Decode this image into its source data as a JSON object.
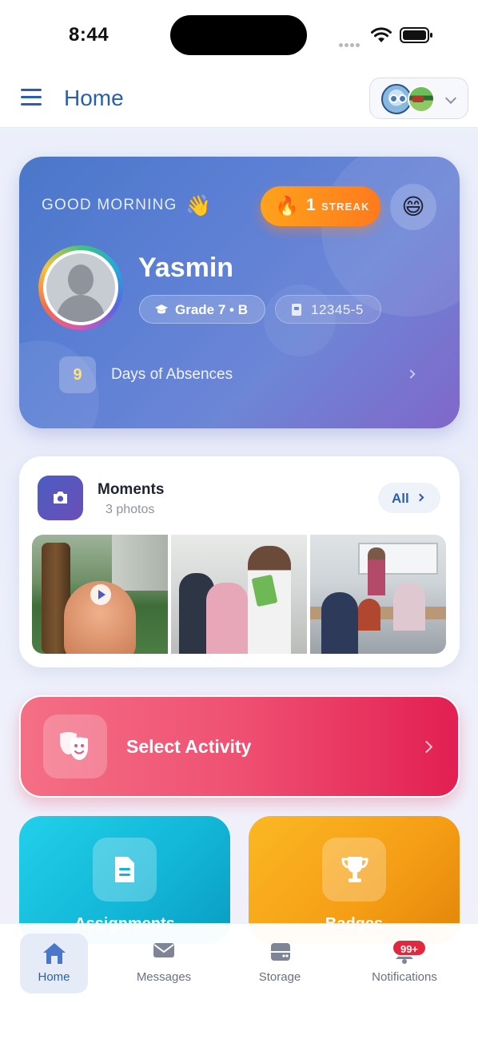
{
  "status_bar": {
    "time": "8:44"
  },
  "header": {
    "title": "Home"
  },
  "hero": {
    "greeting": "GOOD MORNING",
    "greeting_emoji": "👋",
    "streak_emoji": "🔥",
    "streak_count": "1",
    "streak_label": "STREAK",
    "mood_emoji": "😄",
    "student_name": "Yasmin",
    "grade": "Grade 7 • B",
    "student_id": "12345-5",
    "absences_count": "9",
    "absences_label": "Days of Absences"
  },
  "moments": {
    "title": "Moments",
    "count": "3 photos",
    "all_label": "All",
    "photos": [
      "animated-video-thumbnail",
      "students-classroom",
      "classroom-teacher"
    ]
  },
  "activity": {
    "label": "Select Activity"
  },
  "tiles": [
    {
      "label": "Assignments",
      "icon": "document-icon",
      "color": "#12b5d6"
    },
    {
      "label": "Badges",
      "icon": "trophy-icon",
      "color": "#f59d15"
    }
  ],
  "nav": {
    "home": "Home",
    "messages": "Messages",
    "storage": "Storage",
    "notifications": "Notifications",
    "notifications_badge": "99+"
  },
  "colors": {
    "accent": "#2a5fae",
    "hero_gradient_start": "#4a77c9",
    "hero_gradient_end": "#8067c9",
    "streak": "#ff8c1c",
    "activity": "#ef5072",
    "badge": "#e2283f"
  }
}
